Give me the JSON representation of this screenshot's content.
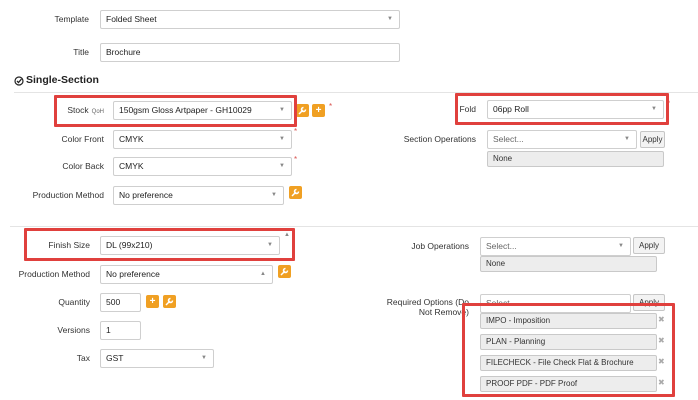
{
  "template": {
    "label": "Template",
    "value": "Folded Sheet"
  },
  "title": {
    "label": "Title",
    "value": "Brochure"
  },
  "section": {
    "title": "Single-Section"
  },
  "stock": {
    "label": "Stock",
    "qoh": "QoH",
    "value": "150gsm Gloss Artpaper - GH10029"
  },
  "color_front": {
    "label": "Color Front",
    "value": "CMYK"
  },
  "color_back": {
    "label": "Color Back",
    "value": "CMYK"
  },
  "production_method_1": {
    "label": "Production Method",
    "value": "No preference"
  },
  "fold": {
    "label": "Fold",
    "value": "06pp Roll"
  },
  "section_operations": {
    "label": "Section Operations",
    "placeholder": "Select...",
    "apply": "Apply",
    "none": "None"
  },
  "finish_size": {
    "label": "Finish Size",
    "value": "DL (99x210)"
  },
  "production_method_2": {
    "label": "Production Method",
    "value": "No preference"
  },
  "quantity": {
    "label": "Quantity",
    "value": "500"
  },
  "versions": {
    "label": "Versions",
    "value": "1"
  },
  "tax": {
    "label": "Tax",
    "value": "GST"
  },
  "job_operations": {
    "label": "Job Operations",
    "placeholder": "Select...",
    "apply": "Apply",
    "none": "None"
  },
  "required_options": {
    "label": "Required Options (Do Not Remove)",
    "placeholder": "Select...",
    "apply": "Apply",
    "items": [
      "IMPO - Imposition",
      "PLAN - Planning",
      "FILECHECK - File Check Flat & Brochure",
      "PROOF PDF - PDF Proof"
    ]
  },
  "colors": {
    "highlight": "#e0403d",
    "accent_button": "#f0a023",
    "required": "#d9534f"
  },
  "icons": [
    "check-circle-icon",
    "wrench-icon",
    "plus-icon",
    "chevron-down-icon",
    "remove-icon"
  ]
}
